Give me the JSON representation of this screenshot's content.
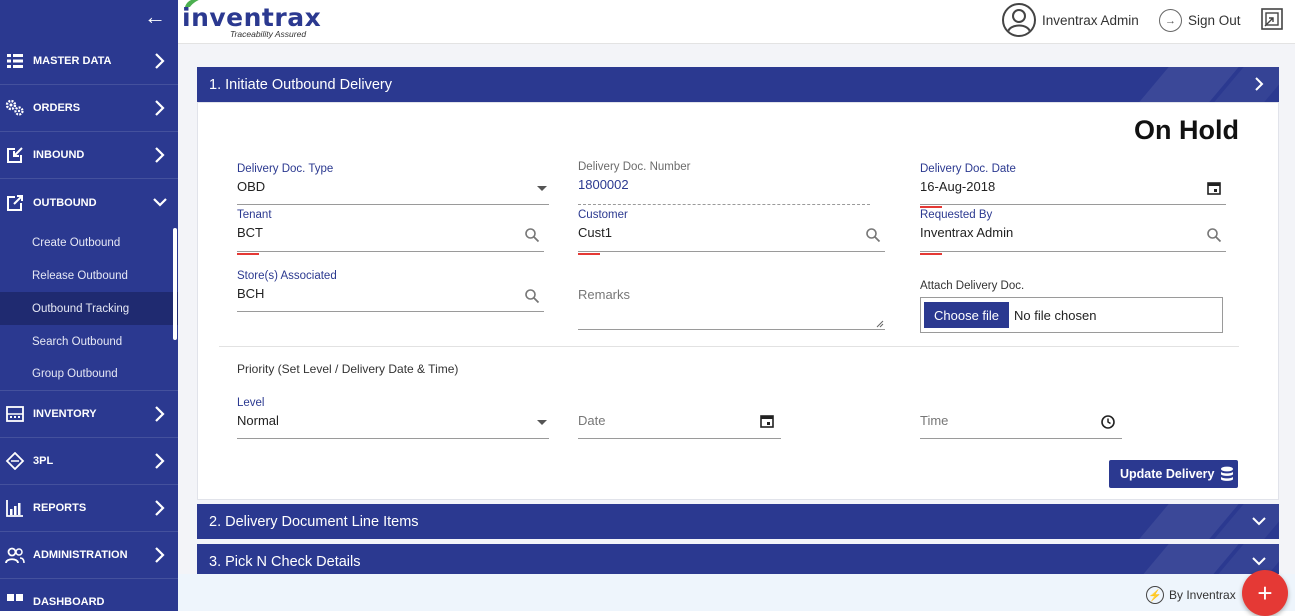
{
  "sidebar": {
    "back_icon": "arrow-left-icon",
    "items": [
      {
        "label": "MASTER DATA",
        "icon": "list-icon"
      },
      {
        "label": "ORDERS",
        "icon": "gears-icon"
      },
      {
        "label": "INBOUND",
        "icon": "inbound-icon"
      },
      {
        "label": "OUTBOUND",
        "icon": "outbound-icon"
      },
      {
        "label": "INVENTORY",
        "icon": "inventory-icon"
      },
      {
        "label": "3PL",
        "icon": "3pl-icon"
      },
      {
        "label": "REPORTS",
        "icon": "reports-icon"
      },
      {
        "label": "ADMINISTRATION",
        "icon": "users-icon"
      },
      {
        "label": "DASHBOARD",
        "icon": "dashboard-icon"
      }
    ],
    "outbound_sub": [
      "Create Outbound",
      "Release Outbound",
      "Outbound Tracking",
      "Search Outbound",
      "Group Outbound"
    ]
  },
  "header": {
    "logo_text": "inventrax",
    "logo_tagline": "Traceability Assured",
    "user_name": "Inventrax Admin",
    "signout_label": "Sign Out"
  },
  "panels": {
    "p1_title": "1. Initiate Outbound Delivery",
    "p2_title": "2. Delivery Document Line Items",
    "p3_title": "3. Pick N Check Details"
  },
  "form": {
    "status": "On Hold",
    "doc_type_label": "Delivery Doc. Type",
    "doc_type_value": "OBD",
    "doc_number_label": "Delivery Doc. Number",
    "doc_number_value": "1800002",
    "doc_date_label": "Delivery Doc. Date",
    "doc_date_value": "16-Aug-2018",
    "tenant_label": "Tenant",
    "tenant_value": "BCT",
    "customer_label": "Customer",
    "customer_value": "Cust1",
    "requested_by_label": "Requested By",
    "requested_by_value": "Inventrax Admin",
    "stores_label": "Store(s) Associated",
    "stores_value": "BCH",
    "remarks_placeholder": "Remarks",
    "attach_label": "Attach Delivery Doc.",
    "choose_file_label": "Choose file",
    "no_file_label": "No file chosen",
    "priority_heading": "Priority (Set Level / Delivery Date & Time)",
    "level_label": "Level",
    "level_value": "Normal",
    "date_placeholder": "Date",
    "time_placeholder": "Time",
    "update_button": "Update Delivery"
  },
  "footer": {
    "by_label": "By Inventrax",
    "fab_label": "+"
  },
  "colors": {
    "primary": "#2b3990",
    "required": "#e53935",
    "fab": "#e53935"
  }
}
